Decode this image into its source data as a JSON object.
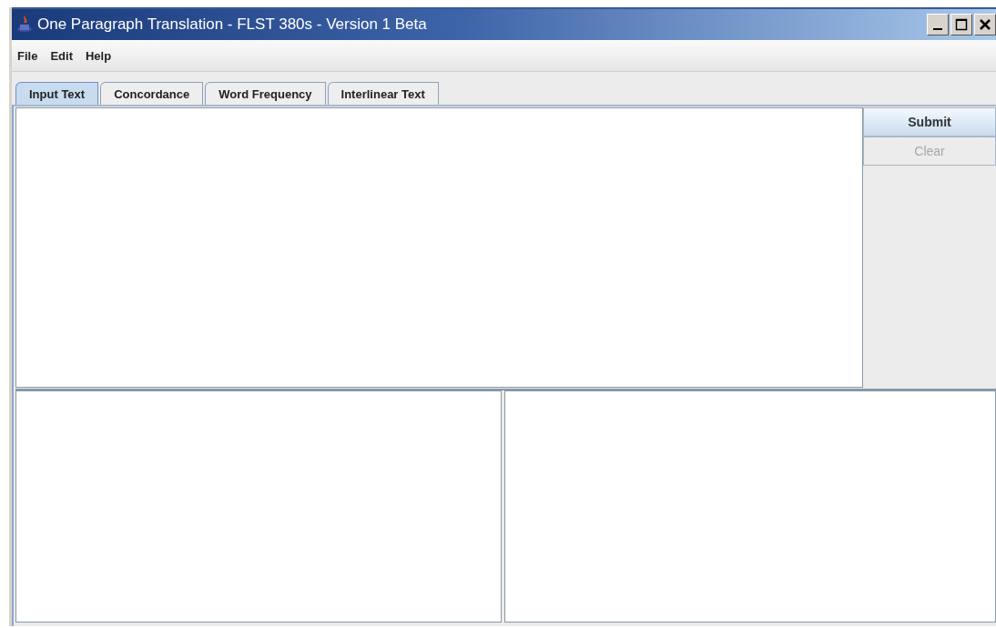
{
  "window": {
    "title": "One Paragraph Translation - FLST 380s - Version 1 Beta"
  },
  "menu": [
    "File",
    "Edit",
    "Help"
  ],
  "tabs": [
    {
      "label": "Input Text",
      "selected": true
    },
    {
      "label": "Concordance",
      "selected": false
    },
    {
      "label": "Word Frequency",
      "selected": false
    },
    {
      "label": "Interlinear Text",
      "selected": false
    }
  ],
  "buttons": [
    {
      "label": "Submit",
      "disabled": false
    },
    {
      "label": "Clear",
      "disabled": true
    }
  ]
}
